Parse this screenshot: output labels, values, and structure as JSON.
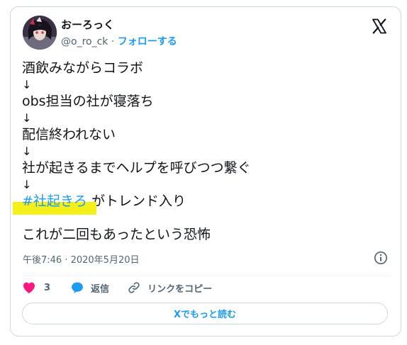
{
  "author": {
    "name": "おーろっく",
    "handle": "@o_ro_ck",
    "separator": " · ",
    "follow_label": "フォローする"
  },
  "tweet": {
    "line1": "酒飲みながらコラボ",
    "line2": "obs担当の社が寝落ち",
    "line3": "配信終われない",
    "line4": "社が起きるまでヘルプを呼びつつ繋ぐ",
    "hashtag": "#社起きろ",
    "line5_suffix": " がトレンド入り",
    "line6": "これが二回もあったという恐怖",
    "arrow": "↓",
    "highlight_color": "#f6f01a"
  },
  "timestamp": "午後7:46 · 2020年5月20日",
  "actions": {
    "like_count": "3",
    "reply_label": "返信",
    "copy_link_label": "リンクをコピー"
  },
  "read_more_label": "Xでもっと読む",
  "icons": {
    "logo": "x-logo-icon",
    "info": "info-icon",
    "like": "heart-icon",
    "reply": "speech-bubble-icon",
    "copy": "link-icon"
  },
  "colors": {
    "accent": "#1d9bf0",
    "like": "#f91880",
    "text": "#0f1419",
    "muted": "#536471"
  }
}
